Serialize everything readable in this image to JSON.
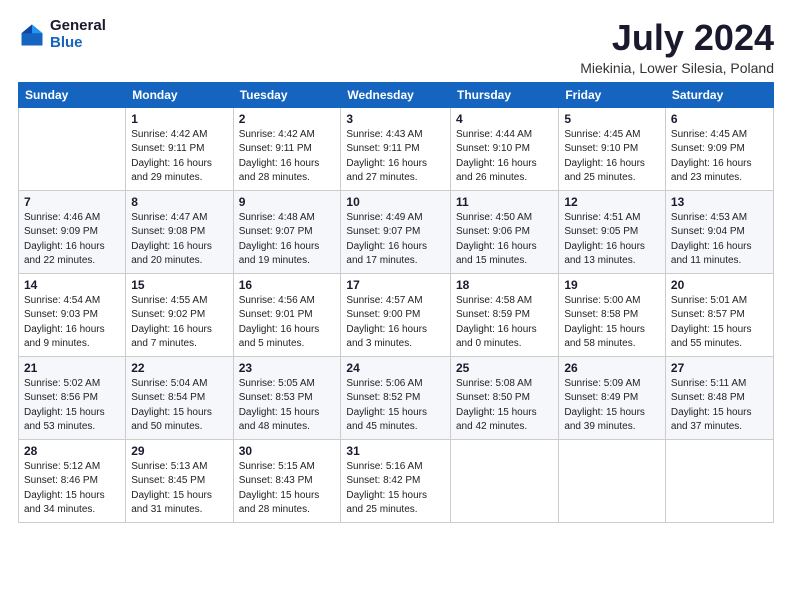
{
  "header": {
    "logo_general": "General",
    "logo_blue": "Blue",
    "month_title": "July 2024",
    "location": "Miekinia, Lower Silesia, Poland"
  },
  "weekdays": [
    "Sunday",
    "Monday",
    "Tuesday",
    "Wednesday",
    "Thursday",
    "Friday",
    "Saturday"
  ],
  "weeks": [
    [
      {
        "day": "",
        "text": ""
      },
      {
        "day": "1",
        "text": "Sunrise: 4:42 AM\nSunset: 9:11 PM\nDaylight: 16 hours\nand 29 minutes."
      },
      {
        "day": "2",
        "text": "Sunrise: 4:42 AM\nSunset: 9:11 PM\nDaylight: 16 hours\nand 28 minutes."
      },
      {
        "day": "3",
        "text": "Sunrise: 4:43 AM\nSunset: 9:11 PM\nDaylight: 16 hours\nand 27 minutes."
      },
      {
        "day": "4",
        "text": "Sunrise: 4:44 AM\nSunset: 9:10 PM\nDaylight: 16 hours\nand 26 minutes."
      },
      {
        "day": "5",
        "text": "Sunrise: 4:45 AM\nSunset: 9:10 PM\nDaylight: 16 hours\nand 25 minutes."
      },
      {
        "day": "6",
        "text": "Sunrise: 4:45 AM\nSunset: 9:09 PM\nDaylight: 16 hours\nand 23 minutes."
      }
    ],
    [
      {
        "day": "7",
        "text": "Sunrise: 4:46 AM\nSunset: 9:09 PM\nDaylight: 16 hours\nand 22 minutes."
      },
      {
        "day": "8",
        "text": "Sunrise: 4:47 AM\nSunset: 9:08 PM\nDaylight: 16 hours\nand 20 minutes."
      },
      {
        "day": "9",
        "text": "Sunrise: 4:48 AM\nSunset: 9:07 PM\nDaylight: 16 hours\nand 19 minutes."
      },
      {
        "day": "10",
        "text": "Sunrise: 4:49 AM\nSunset: 9:07 PM\nDaylight: 16 hours\nand 17 minutes."
      },
      {
        "day": "11",
        "text": "Sunrise: 4:50 AM\nSunset: 9:06 PM\nDaylight: 16 hours\nand 15 minutes."
      },
      {
        "day": "12",
        "text": "Sunrise: 4:51 AM\nSunset: 9:05 PM\nDaylight: 16 hours\nand 13 minutes."
      },
      {
        "day": "13",
        "text": "Sunrise: 4:53 AM\nSunset: 9:04 PM\nDaylight: 16 hours\nand 11 minutes."
      }
    ],
    [
      {
        "day": "14",
        "text": "Sunrise: 4:54 AM\nSunset: 9:03 PM\nDaylight: 16 hours\nand 9 minutes."
      },
      {
        "day": "15",
        "text": "Sunrise: 4:55 AM\nSunset: 9:02 PM\nDaylight: 16 hours\nand 7 minutes."
      },
      {
        "day": "16",
        "text": "Sunrise: 4:56 AM\nSunset: 9:01 PM\nDaylight: 16 hours\nand 5 minutes."
      },
      {
        "day": "17",
        "text": "Sunrise: 4:57 AM\nSunset: 9:00 PM\nDaylight: 16 hours\nand 3 minutes."
      },
      {
        "day": "18",
        "text": "Sunrise: 4:58 AM\nSunset: 8:59 PM\nDaylight: 16 hours\nand 0 minutes."
      },
      {
        "day": "19",
        "text": "Sunrise: 5:00 AM\nSunset: 8:58 PM\nDaylight: 15 hours\nand 58 minutes."
      },
      {
        "day": "20",
        "text": "Sunrise: 5:01 AM\nSunset: 8:57 PM\nDaylight: 15 hours\nand 55 minutes."
      }
    ],
    [
      {
        "day": "21",
        "text": "Sunrise: 5:02 AM\nSunset: 8:56 PM\nDaylight: 15 hours\nand 53 minutes."
      },
      {
        "day": "22",
        "text": "Sunrise: 5:04 AM\nSunset: 8:54 PM\nDaylight: 15 hours\nand 50 minutes."
      },
      {
        "day": "23",
        "text": "Sunrise: 5:05 AM\nSunset: 8:53 PM\nDaylight: 15 hours\nand 48 minutes."
      },
      {
        "day": "24",
        "text": "Sunrise: 5:06 AM\nSunset: 8:52 PM\nDaylight: 15 hours\nand 45 minutes."
      },
      {
        "day": "25",
        "text": "Sunrise: 5:08 AM\nSunset: 8:50 PM\nDaylight: 15 hours\nand 42 minutes."
      },
      {
        "day": "26",
        "text": "Sunrise: 5:09 AM\nSunset: 8:49 PM\nDaylight: 15 hours\nand 39 minutes."
      },
      {
        "day": "27",
        "text": "Sunrise: 5:11 AM\nSunset: 8:48 PM\nDaylight: 15 hours\nand 37 minutes."
      }
    ],
    [
      {
        "day": "28",
        "text": "Sunrise: 5:12 AM\nSunset: 8:46 PM\nDaylight: 15 hours\nand 34 minutes."
      },
      {
        "day": "29",
        "text": "Sunrise: 5:13 AM\nSunset: 8:45 PM\nDaylight: 15 hours\nand 31 minutes."
      },
      {
        "day": "30",
        "text": "Sunrise: 5:15 AM\nSunset: 8:43 PM\nDaylight: 15 hours\nand 28 minutes."
      },
      {
        "day": "31",
        "text": "Sunrise: 5:16 AM\nSunset: 8:42 PM\nDaylight: 15 hours\nand 25 minutes."
      },
      {
        "day": "",
        "text": ""
      },
      {
        "day": "",
        "text": ""
      },
      {
        "day": "",
        "text": ""
      }
    ]
  ]
}
